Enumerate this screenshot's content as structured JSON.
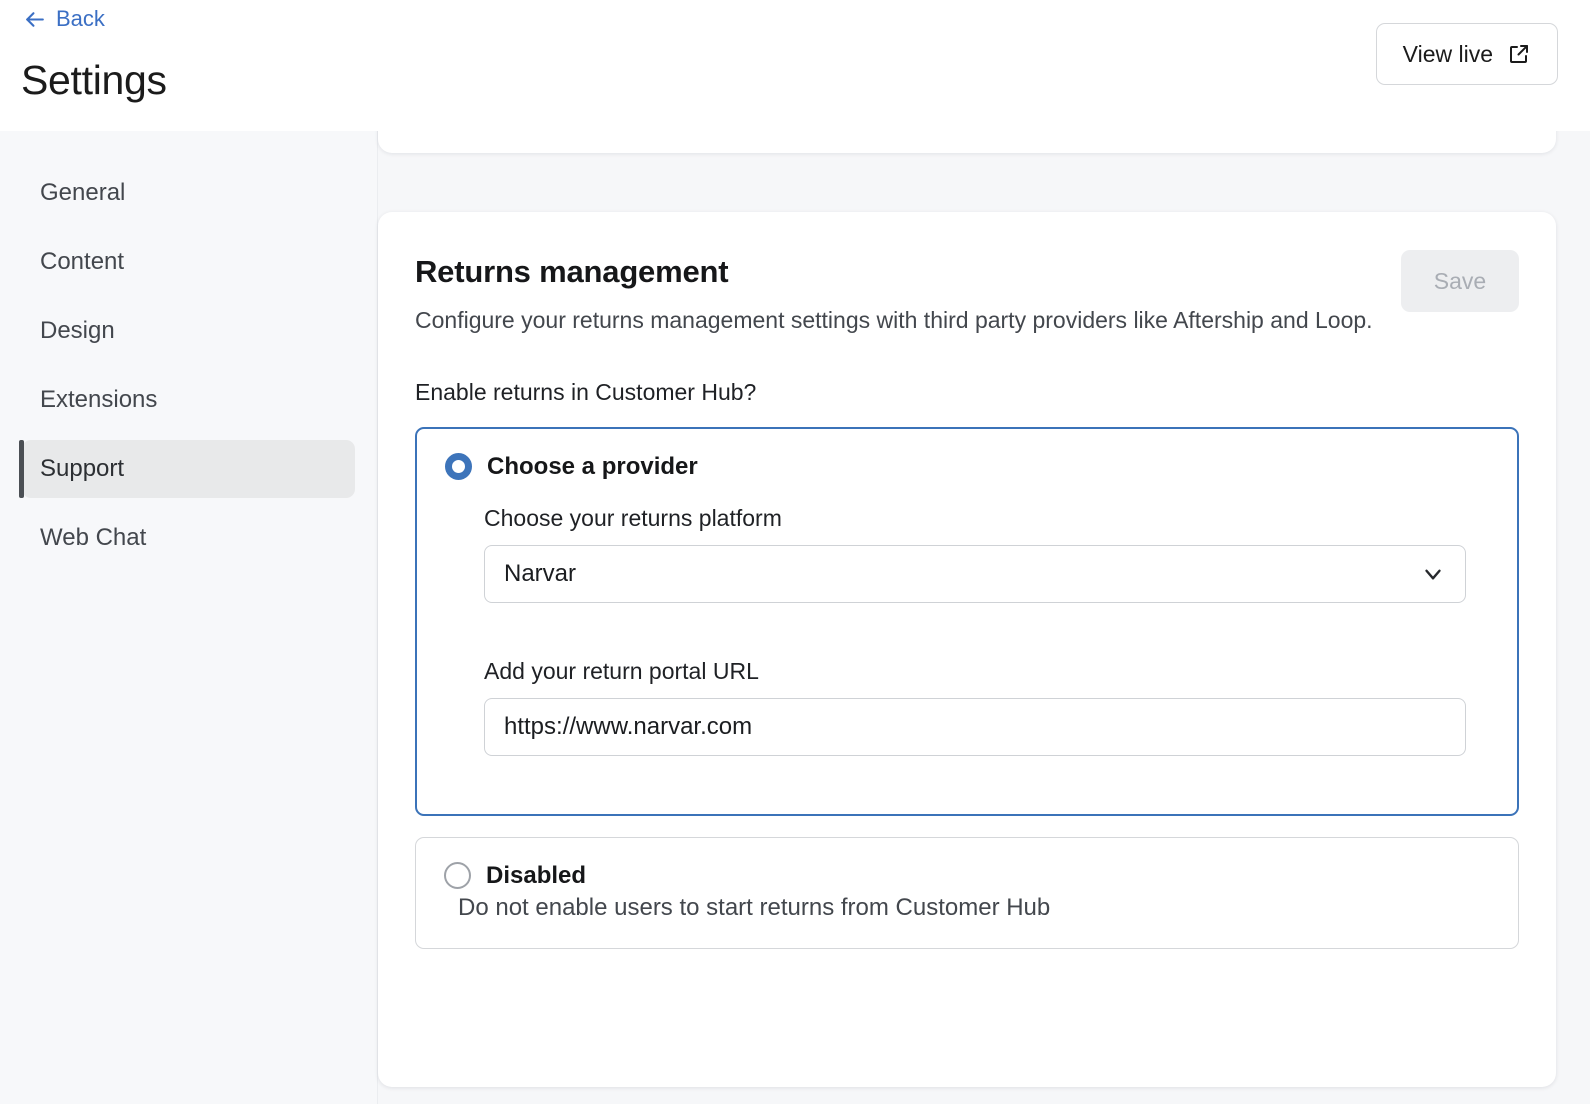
{
  "header": {
    "back_label": "Back",
    "back_icon": "arrow-left-icon",
    "title": "Settings",
    "view_live_label": "View live",
    "view_live_icon": "external-link-icon"
  },
  "sidebar": {
    "items": [
      {
        "label": "General",
        "active": false
      },
      {
        "label": "Content",
        "active": false
      },
      {
        "label": "Design",
        "active": false
      },
      {
        "label": "Extensions",
        "active": false
      },
      {
        "label": "Support",
        "active": true
      },
      {
        "label": "Web Chat",
        "active": false
      }
    ]
  },
  "main": {
    "card": {
      "title": "Returns management",
      "description": "Configure your returns management settings with third party providers like Aftership and Loop.",
      "save_label": "Save",
      "save_disabled": true,
      "question_label": "Enable returns in Customer Hub?",
      "options": [
        {
          "id": "choose-a-provider",
          "title": "Choose a provider",
          "selected": true,
          "platform_label": "Choose your returns platform",
          "platform_value": "Narvar",
          "platform_icon": "chevron-down-icon",
          "url_label": "Add your return portal URL",
          "url_value": "https://www.narvar.com"
        },
        {
          "id": "disabled",
          "title": "Disabled",
          "selected": false,
          "description": "Do not enable users to start returns from Customer Hub"
        }
      ]
    }
  },
  "colors": {
    "accent_blue": "#3b73b9",
    "link_blue": "#3b6fc4",
    "page_bg": "#f6f7f9",
    "sidebar_bg": "#f7f8fa",
    "active_item_bg": "#e8e9ea",
    "active_item_bar": "#4b4f54",
    "save_disabled_bg": "#edeef0",
    "save_disabled_text": "#a9adb4"
  }
}
